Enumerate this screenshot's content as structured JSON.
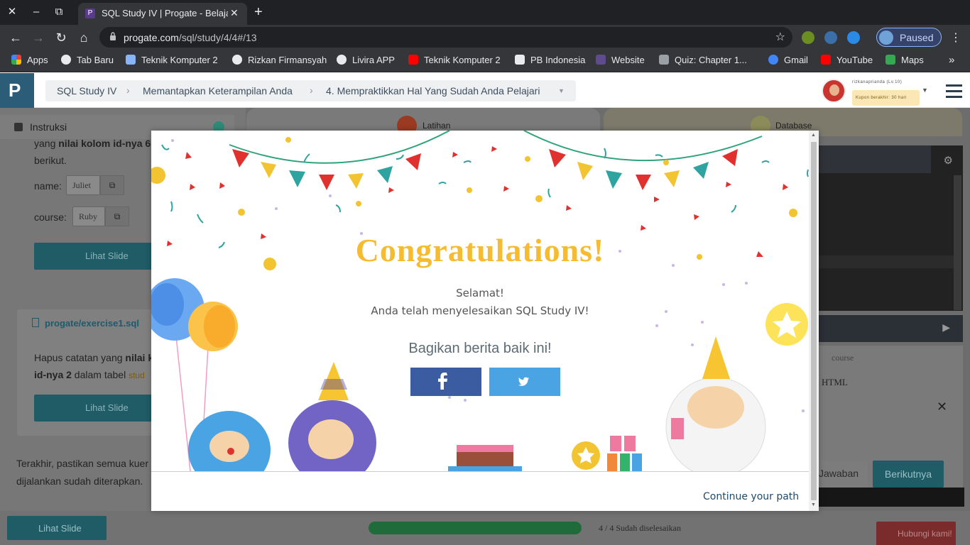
{
  "browser": {
    "tab_title": "SQL Study IV | Progate - Belajar",
    "tab_favicon": "P",
    "url_host": "progate.com",
    "url_path": "/sql/study/4/4#/13",
    "profile_label": "Paused"
  },
  "bookmarks": [
    {
      "label": "Apps",
      "icon": "apps-grid-icon",
      "color": "#ea4335"
    },
    {
      "label": "Tab Baru",
      "icon": "globe-icon",
      "color": "#e8eaed"
    },
    {
      "label": "Teknik Komputer 2",
      "icon": "screen-icon",
      "color": "#8ab4f8"
    },
    {
      "label": "Rizkan Firmansyah",
      "icon": "globe-icon",
      "color": "#e8eaed"
    },
    {
      "label": "Livira APP",
      "icon": "globe-icon",
      "color": "#e8eaed"
    },
    {
      "label": "Teknik Komputer 2",
      "icon": "youtube-icon",
      "color": "#ff0000"
    },
    {
      "label": "PB Indonesia",
      "icon": "z-logo-icon",
      "color": "#e8eaed"
    },
    {
      "label": "Website",
      "icon": "window-icon",
      "color": "#5e4c8c"
    },
    {
      "label": "Quiz: Chapter 1...",
      "icon": "dots-icon",
      "color": "#9aa0a6"
    },
    {
      "label": "Gmail",
      "icon": "google-icon",
      "color": "#4285f4"
    },
    {
      "label": "YouTube",
      "icon": "youtube-icon",
      "color": "#ff0000"
    },
    {
      "label": "Maps",
      "icon": "maps-icon",
      "color": "#34a853"
    }
  ],
  "header": {
    "crumbs": [
      "SQL Study IV",
      "Memantapkan Keterampilan Anda",
      "4. Mempraktikkan Hal Yang Sudah Anda Pelajari"
    ],
    "user_name": "rizkanaprianda (Lv.10)",
    "coupon": "Kupon berakhir: 30 hari"
  },
  "left": {
    "heading": "Instruksi",
    "intro_a": "yang ",
    "intro_b": "nilai kolom id-nya 6",
    "intro_c": "berikut.",
    "name_label": "name:",
    "name_value": "Juliet",
    "course_label": "course:",
    "course_value": "Ruby",
    "slide_label": "Lihat Slide",
    "file_title": "progate/exercise1.sql",
    "task_a": "Hapus catatan yang ",
    "task_b": "nilai k",
    "task_c": "id-nya 2",
    "task_d": " dalam tabel ",
    "task_e": "stud",
    "slide_label2": "Lihat Slide",
    "final_1": "Terakhir, pastikan semua kuer",
    "final_2": "dijalankan sudah diterapkan."
  },
  "right": {
    "tab_latihan": "Latihan",
    "tab_database": "Database",
    "result_header": "course",
    "result_cell": "HTML",
    "btn_jawaban": "Jawaban",
    "btn_next": "Berikutnya"
  },
  "footer": {
    "slide_label": "Lihat Slide",
    "progress_fraction": 1.0,
    "status": "4 / 4 Sudah diselesaikan",
    "contact": "Hubungi kami!"
  },
  "modal": {
    "title": "Congratulations!",
    "line1": "Selamat!",
    "line2": "Anda telah menyelesaikan SQL Study IV!",
    "share": "Bagikan berita baik ini!",
    "facebook_icon": "facebook-icon",
    "twitter_icon": "twitter-icon",
    "continue": "Continue your path",
    "colors": {
      "title": "#f7bb2f",
      "facebook": "#3b5ca0",
      "twitter": "#4aa3e3"
    }
  }
}
